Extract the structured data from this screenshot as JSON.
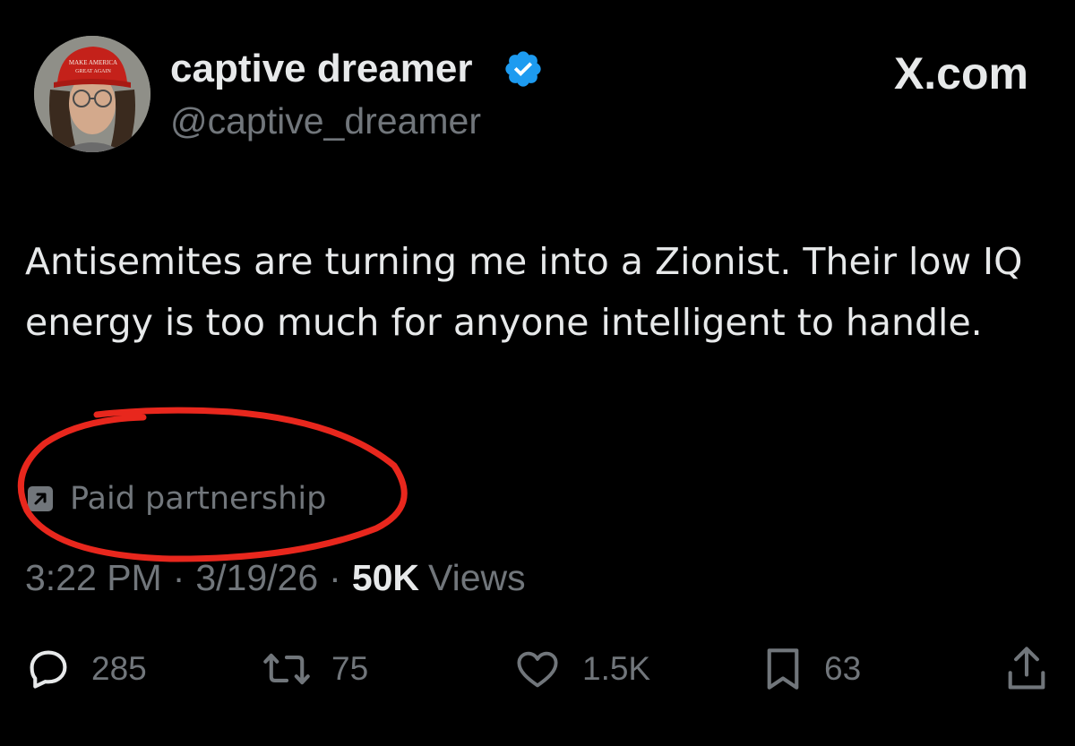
{
  "header": {
    "display_name": "captive dreamer",
    "handle": "@captive_dreamer",
    "brand": "X.com",
    "avatar_hat_text": "MAKE AMERICA GREAT AGAIN"
  },
  "tweet": {
    "text": "Antisemites are turning me into a Zionist. Their low IQ energy is too much for anyone intelligent to handle."
  },
  "partnership": {
    "label": "Paid partnership",
    "annotation_color": "#e8271d"
  },
  "meta": {
    "time": "3:22 PM",
    "separator": "·",
    "date": "3/19/26",
    "views_count": "50K",
    "views_label": "Views"
  },
  "actions": {
    "replies": "285",
    "reposts": "75",
    "likes": "1.5K",
    "bookmarks": "63"
  },
  "colors": {
    "background": "#000000",
    "primary_text": "#e7e9ea",
    "secondary_text": "#71767b",
    "verified_badge": "#1d9bf0"
  },
  "icons": [
    "verified-badge-icon",
    "paid-partnership-icon",
    "reply-icon",
    "repost-icon",
    "like-icon",
    "bookmark-icon",
    "share-icon"
  ]
}
